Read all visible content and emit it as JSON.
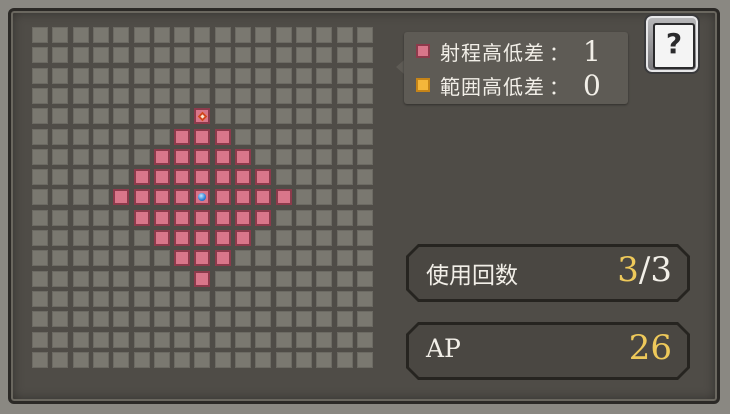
{
  "range_grid": {
    "columns": 17,
    "rows": 17,
    "attack_range": 4,
    "caster_cell": [
      8,
      8
    ],
    "target_cell": [
      8,
      4
    ],
    "colors": {
      "empty": "#7a7870",
      "range": "#d9768a",
      "area": "#f4b63a",
      "caster": "#2d7fd8",
      "target": "#d24521"
    }
  },
  "legend": {
    "range_label": "射程高低差",
    "range_colon": "：",
    "range_value": "1",
    "area_label": "範囲高低差",
    "area_colon": "：",
    "area_value": "0"
  },
  "help_button": {
    "icon": "question-book-icon",
    "glyph": "?"
  },
  "uses": {
    "label": "使用回数",
    "current": "3",
    "separator": "/",
    "max": "3"
  },
  "ap": {
    "label": "AP",
    "value": "26"
  }
}
